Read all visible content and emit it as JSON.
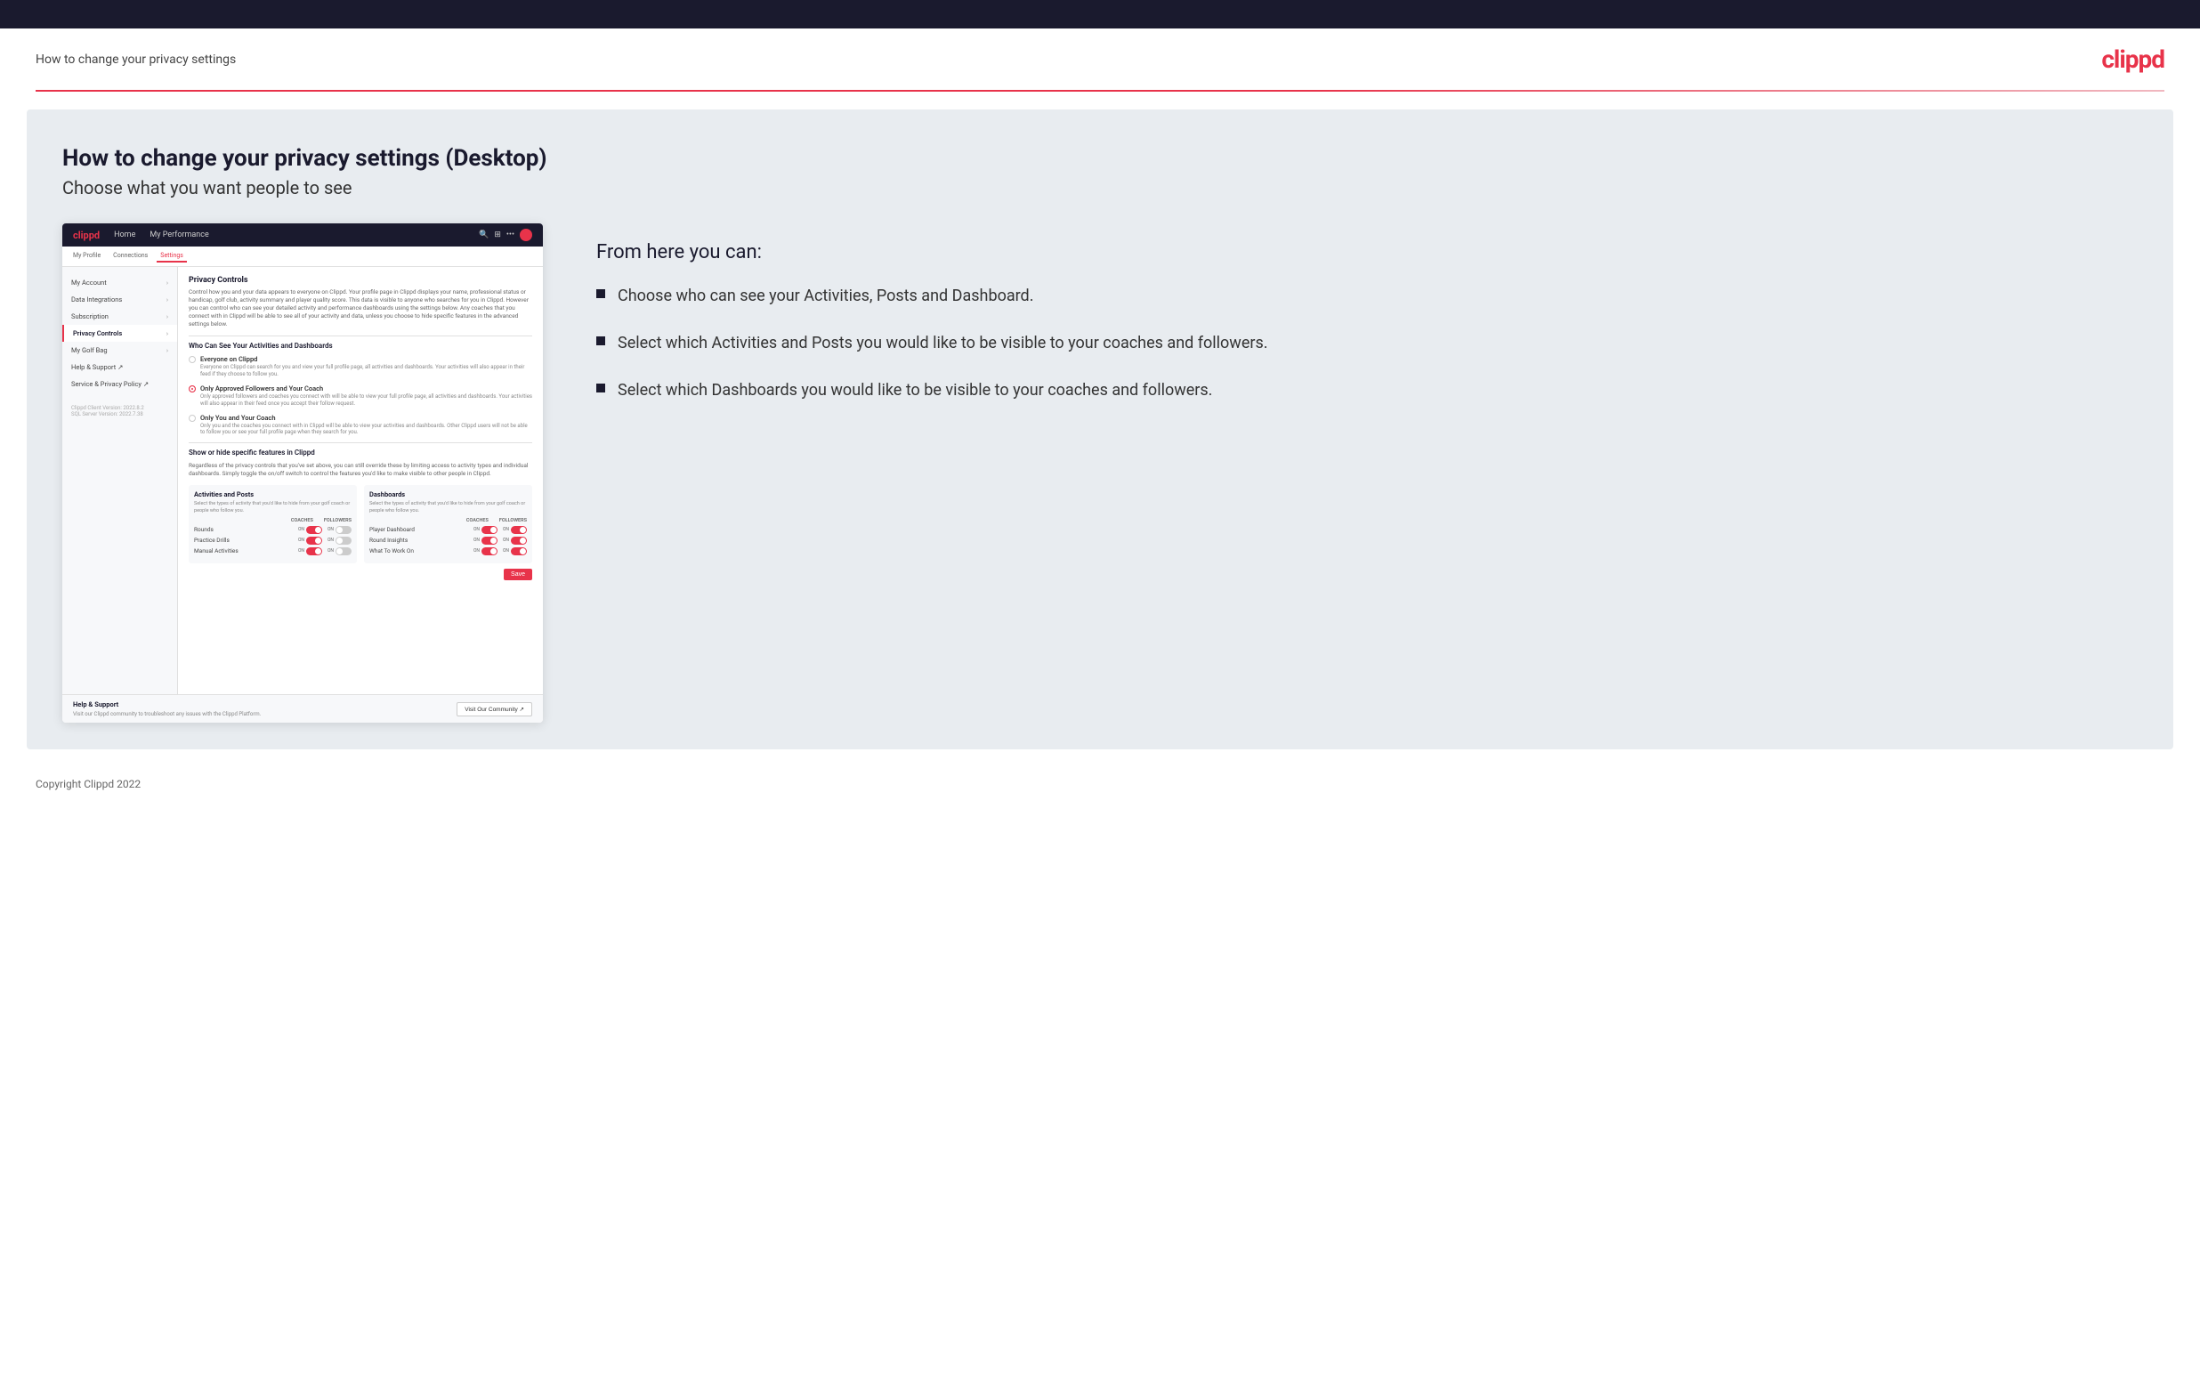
{
  "topBar": {},
  "header": {
    "title": "How to change your privacy settings",
    "logo": "clippd"
  },
  "main": {
    "heading": "How to change your privacy settings (Desktop)",
    "subheading": "Choose what you want people to see",
    "mockApp": {
      "navbar": {
        "logo": "clippd",
        "navItems": [
          "Home",
          "My Performance"
        ]
      },
      "tabs": [
        "My Profile",
        "Connections",
        "Settings"
      ],
      "activeTab": "Settings",
      "sidebar": {
        "items": [
          {
            "label": "My Account",
            "active": false
          },
          {
            "label": "Data Integrations",
            "active": false
          },
          {
            "label": "Subscription",
            "active": false
          },
          {
            "label": "Privacy Controls",
            "active": true
          },
          {
            "label": "My Golf Bag",
            "active": false
          },
          {
            "label": "Help & Support",
            "active": false
          },
          {
            "label": "Service & Privacy Policy",
            "active": false
          }
        ],
        "versionInfo": "Clippd Client Version: 2022.8.2\nSQL Server Version: 2022.7.38"
      },
      "privacyControls": {
        "sectionTitle": "Privacy Controls",
        "sectionDesc": "Control how you and your data appears to everyone on Clippd. Your profile page in Clippd displays your name, professional status or handicap, golf club, activity summary and player quality score. This data is visible to anyone who searches for you in Clippd. However you can control who can see your detailed activity and performance dashboards using the settings below. Any coaches that you connect with in Clippd will be able to see all of your activity and data, unless you choose to hide specific features in the advanced settings below.",
        "whoCanSeeTitle": "Who Can See Your Activities and Dashboards",
        "radioOptions": [
          {
            "label": "Everyone on Clippd",
            "desc": "Everyone on Clippd can search for you and view your full profile page, all activities and dashboards. Your activities will also appear in their feed if they choose to follow you.",
            "selected": false
          },
          {
            "label": "Only Approved Followers and Your Coach",
            "desc": "Only approved followers and coaches you connect with will be able to view your full profile page, all activities and dashboards. Your activities will also appear in their feed once you accept their follow request.",
            "selected": true
          },
          {
            "label": "Only You and Your Coach",
            "desc": "Only you and the coaches you connect with in Clippd will be able to view your activities and dashboards. Other Clippd users will not be able to follow you or see your full profile page when they search for you.",
            "selected": false
          }
        ],
        "showHideTitle": "Show or hide specific features in Clippd",
        "showHideDesc": "Regardless of the privacy controls that you've set above, you can still override these by limiting access to activity types and individual dashboards. Simply toggle the on/off switch to control the features you'd like to make visible to other people in Clippd.",
        "activitiesTable": {
          "title": "Activities and Posts",
          "desc": "Select the types of activity that you'd like to hide from your golf coach or people who follow you.",
          "headers": [
            "COACHES",
            "FOLLOWERS"
          ],
          "rows": [
            {
              "label": "Rounds",
              "coachOn": true,
              "followerOn": false
            },
            {
              "label": "Practice Drills",
              "coachOn": true,
              "followerOn": false
            },
            {
              "label": "Manual Activities",
              "coachOn": true,
              "followerOn": false
            }
          ]
        },
        "dashboardsTable": {
          "title": "Dashboards",
          "desc": "Select the types of activity that you'd like to hide from your golf coach or people who follow you.",
          "headers": [
            "COACHES",
            "FOLLOWERS"
          ],
          "rows": [
            {
              "label": "Player Dashboard",
              "coachOn": true,
              "followerOn": true
            },
            {
              "label": "Round Insights",
              "coachOn": true,
              "followerOn": true
            },
            {
              "label": "What To Work On",
              "coachOn": true,
              "followerOn": true
            }
          ]
        },
        "saveButton": "Save"
      },
      "helpBar": {
        "title": "Help & Support",
        "desc": "Visit our Clippd community to troubleshoot any issues with the Clippd Platform.",
        "buttonLabel": "Visit Our Community"
      }
    },
    "rightPanel": {
      "fromHereTitle": "From here you can:",
      "bullets": [
        "Choose who can see your Activities, Posts and Dashboard.",
        "Select which Activities and Posts you would like to be visible to your coaches and followers.",
        "Select which Dashboards you would like to be visible to your coaches and followers."
      ]
    }
  },
  "footer": {
    "copyright": "Copyright Clippd 2022"
  }
}
